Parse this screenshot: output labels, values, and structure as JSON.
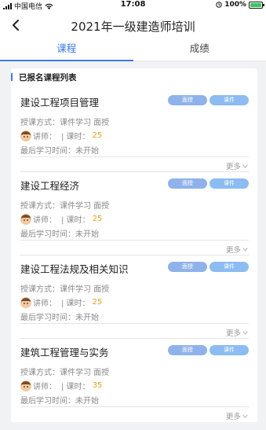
{
  "status_bar": {
    "carrier": "中国电信",
    "time": "17:08",
    "battery_text": "100%"
  },
  "header": {
    "title": "2021年一级建造师培训"
  },
  "tabs": [
    {
      "label": "课程",
      "active": true
    },
    {
      "label": "成绩",
      "active": false
    }
  ],
  "section": {
    "title": "已报名课程列表"
  },
  "courses": [
    {
      "name": "建设工程项目管理",
      "badge_face": "面授",
      "badge_course": "课件",
      "mode_label": "授课方式：课件学习  面授",
      "teacher_label": "讲师：",
      "hours_label": "| 课时：",
      "hours": "25",
      "last_study": "最后学习时间：未开始",
      "more": "更多"
    },
    {
      "name": "建设工程经济",
      "badge_face": "面授",
      "badge_course": "课件",
      "mode_label": "授课方式：课件学习  面授",
      "teacher_label": "讲师：",
      "hours_label": "| 课时：",
      "hours": "25",
      "last_study": "最后学习时间：未开始",
      "more": "更多"
    },
    {
      "name": "建设工程法规及相关知识",
      "badge_face": "面授",
      "badge_course": "课件",
      "mode_label": "授课方式：课件学习  面授",
      "teacher_label": "讲师：",
      "hours_label": "| 课时：",
      "hours": "25",
      "last_study": "最后学习时间：未开始",
      "more": "更多"
    },
    {
      "name": "建筑工程管理与实务",
      "badge_face": "面授",
      "badge_course": "课件",
      "mode_label": "授课方式：课件学习  面授",
      "teacher_label": "讲师：",
      "hours_label": "| 课时：",
      "hours": "35",
      "last_study": "最后学习时间：未开始",
      "more": "更多"
    }
  ],
  "colors": {
    "accent": "#3d7be0",
    "hours": "#e0a01f"
  }
}
